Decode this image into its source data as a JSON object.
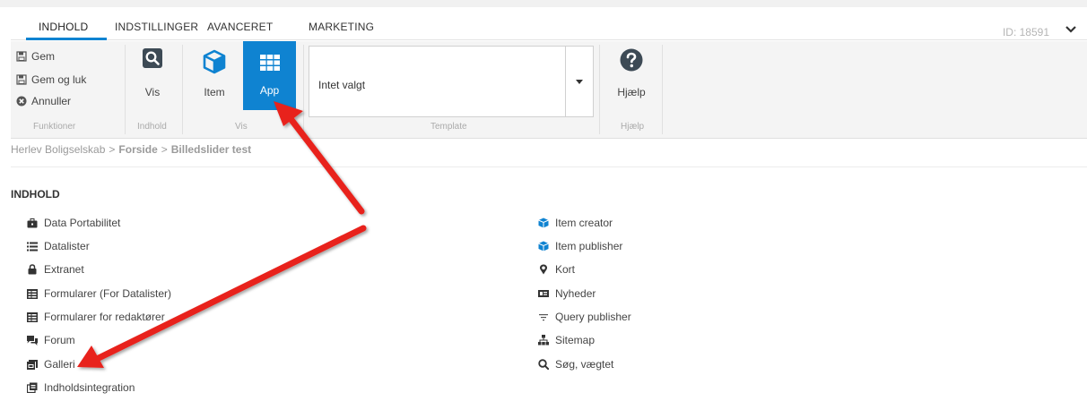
{
  "tabs": [
    {
      "label": "INDHOLD",
      "active": true
    },
    {
      "label": "INDSTILLINGER",
      "active": false
    },
    {
      "label": "AVANCERET",
      "active": false
    },
    {
      "label": "MARKETING",
      "active": false
    }
  ],
  "record_id": "ID: 18591",
  "ribbon": {
    "funktioner": {
      "label": "Funktioner",
      "save": "Gem",
      "save_close": "Gem og luk",
      "cancel": "Annuller"
    },
    "indhold": {
      "label": "Indhold",
      "view": "Vis"
    },
    "vis": {
      "label": "Vis",
      "item": "Item",
      "app": "App",
      "selected": "App"
    },
    "template": {
      "label": "Template",
      "value": "Intet valgt"
    },
    "hjaelp": {
      "label": "Hjælp",
      "help": "Hjælp"
    }
  },
  "breadcrumb": {
    "root": "Herlev Boligselskab",
    "separator": ">",
    "items": [
      "Forside",
      "Billedslider test"
    ]
  },
  "content": {
    "title": "INDHOLD",
    "left_column": [
      {
        "label": "Data Portabilitet",
        "icon": "briefcase-icon"
      },
      {
        "label": "Datalister",
        "icon": "list-icon"
      },
      {
        "label": "Extranet",
        "icon": "lock-icon"
      },
      {
        "label": "Formularer (For Datalister)",
        "icon": "form-icon"
      },
      {
        "label": "Formularer for redaktører",
        "icon": "form-icon"
      },
      {
        "label": "Forum",
        "icon": "chat-icon"
      },
      {
        "label": "Galleri",
        "icon": "gallery-icon"
      },
      {
        "label": "Indholdsintegration",
        "icon": "integration-icon"
      }
    ],
    "right_column": [
      {
        "label": "Item creator",
        "icon": "cube-icon"
      },
      {
        "label": "Item publisher",
        "icon": "cube-icon"
      },
      {
        "label": "Kort",
        "icon": "map-marker-icon"
      },
      {
        "label": "Nyheder",
        "icon": "news-icon"
      },
      {
        "label": "Query publisher",
        "icon": "filter-icon"
      },
      {
        "label": "Sitemap",
        "icon": "sitemap-icon"
      },
      {
        "label": "Søg, vægtet",
        "icon": "search-icon"
      }
    ]
  },
  "colors": {
    "accent": "#0f83d1",
    "annotation_arrow": "#e8211b"
  }
}
